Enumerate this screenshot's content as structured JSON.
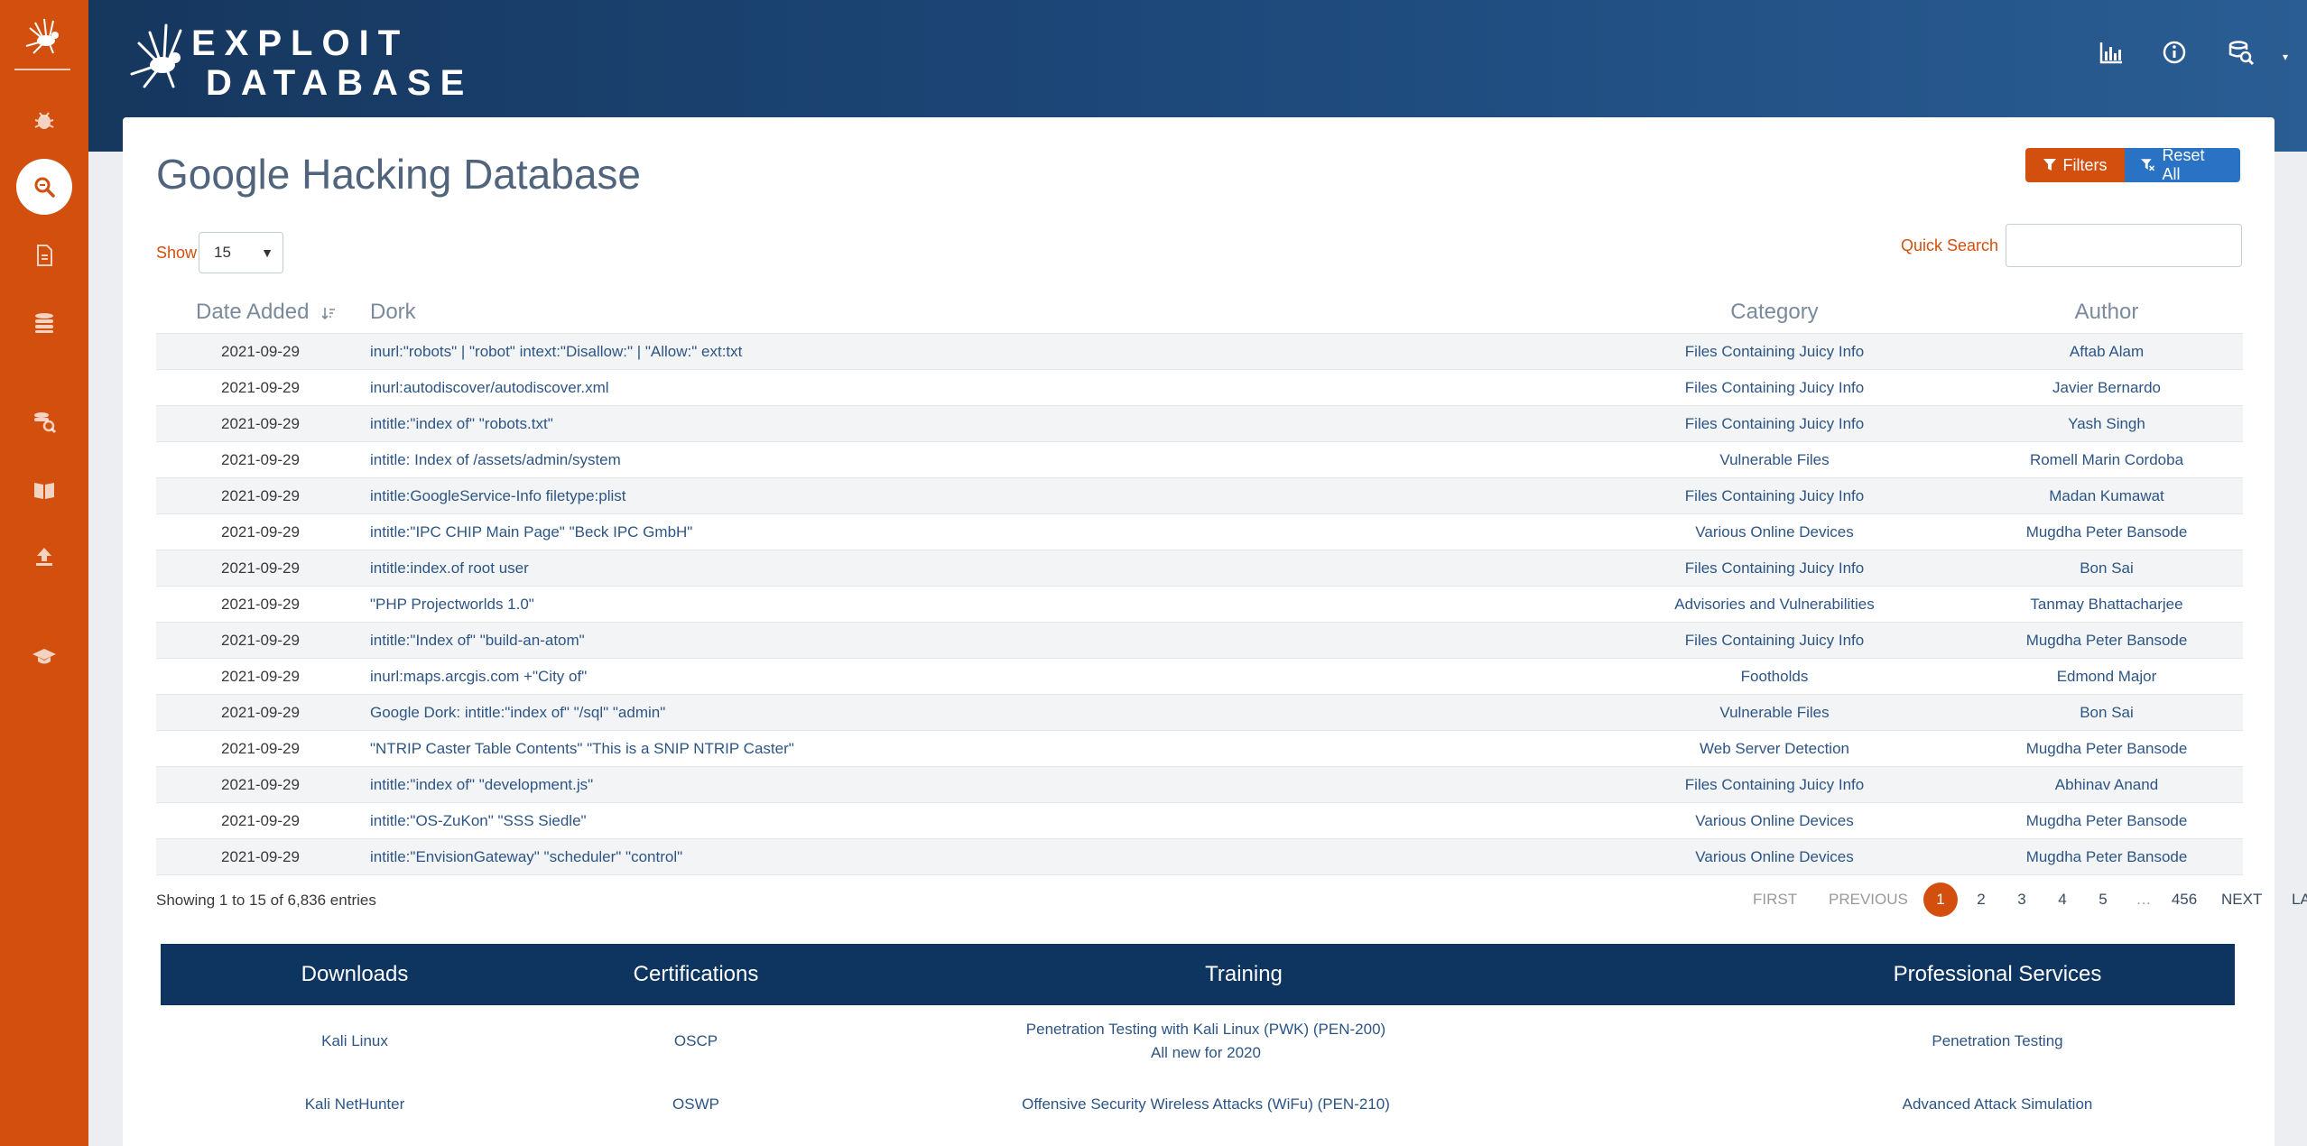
{
  "brand": {
    "line1": "EXPLOIT",
    "line2": "DATABASE"
  },
  "colors": {
    "accent": "#d24f0e",
    "header": "#16375e",
    "link": "#2c5585",
    "reset_button": "#2a73c4"
  },
  "sidebar": {
    "items": [
      {
        "icon": "bug-icon"
      },
      {
        "icon": "search-icon",
        "active": true
      },
      {
        "icon": "file-icon"
      },
      {
        "icon": "database-stack-icon"
      },
      {
        "icon": "search-database-icon"
      },
      {
        "icon": "book-icon"
      },
      {
        "icon": "upload-icon"
      },
      {
        "icon": "graduation-cap-icon"
      }
    ]
  },
  "header_icons": [
    "stats-chart-icon",
    "info-icon",
    "search-database-icon"
  ],
  "page": {
    "title": "Google Hacking Database"
  },
  "buttons": {
    "filters": "Filters",
    "reset_all": "Reset All"
  },
  "controls": {
    "show_label": "Show",
    "show_value": "15",
    "quick_search_label": "Quick Search",
    "quick_search_value": ""
  },
  "table": {
    "columns": {
      "date": "Date Added",
      "dork": "Dork",
      "category": "Category",
      "author": "Author"
    },
    "rows": [
      {
        "date": "2021-09-29",
        "dork": "inurl:\"robots\" | \"robot\" intext:\"Disallow:\" | \"Allow:\" ext:txt",
        "category": "Files Containing Juicy Info",
        "author": "Aftab Alam"
      },
      {
        "date": "2021-09-29",
        "dork": "inurl:autodiscover/autodiscover.xml",
        "category": "Files Containing Juicy Info",
        "author": "Javier Bernardo"
      },
      {
        "date": "2021-09-29",
        "dork": "intitle:\"index of\" \"robots.txt\"",
        "category": "Files Containing Juicy Info",
        "author": "Yash Singh"
      },
      {
        "date": "2021-09-29",
        "dork": "intitle: Index of /assets/admin/system",
        "category": "Vulnerable Files",
        "author": "Romell Marin Cordoba"
      },
      {
        "date": "2021-09-29",
        "dork": "intitle:GoogleService-Info filetype:plist",
        "category": "Files Containing Juicy Info",
        "author": "Madan Kumawat"
      },
      {
        "date": "2021-09-29",
        "dork": "intitle:\"IPC CHIP Main Page\" \"Beck IPC GmbH\"",
        "category": "Various Online Devices",
        "author": "Mugdha Peter Bansode"
      },
      {
        "date": "2021-09-29",
        "dork": "intitle:index.of root user",
        "category": "Files Containing Juicy Info",
        "author": "Bon Sai"
      },
      {
        "date": "2021-09-29",
        "dork": "\"PHP Projectworlds 1.0\"",
        "category": "Advisories and Vulnerabilities",
        "author": "Tanmay Bhattacharjee"
      },
      {
        "date": "2021-09-29",
        "dork": "intitle:\"Index of\" \"build-an-atom\"",
        "category": "Files Containing Juicy Info",
        "author": "Mugdha Peter Bansode"
      },
      {
        "date": "2021-09-29",
        "dork": "inurl:maps.arcgis.com +\"City of\"",
        "category": "Footholds",
        "author": "Edmond Major"
      },
      {
        "date": "2021-09-29",
        "dork": "Google Dork: intitle:\"index of\" \"/sql\" \"admin\"",
        "category": "Vulnerable Files",
        "author": "Bon Sai"
      },
      {
        "date": "2021-09-29",
        "dork": "\"NTRIP Caster Table Contents\" \"This is a SNIP NTRIP Caster\"",
        "category": "Web Server Detection",
        "author": "Mugdha Peter Bansode"
      },
      {
        "date": "2021-09-29",
        "dork": "intitle:\"index of\" \"development.js\"",
        "category": "Files Containing Juicy Info",
        "author": "Abhinav Anand"
      },
      {
        "date": "2021-09-29",
        "dork": "intitle:\"OS-ZuKon\" \"SSS Siedle\"",
        "category": "Various Online Devices",
        "author": "Mugdha Peter Bansode"
      },
      {
        "date": "2021-09-29",
        "dork": "intitle:\"EnvisionGateway\" \"scheduler\" \"control\"",
        "category": "Various Online Devices",
        "author": "Mugdha Peter Bansode"
      }
    ]
  },
  "pagination": {
    "info": "Showing 1 to 15 of 6,836 entries",
    "first": "FIRST",
    "previous": "PREVIOUS",
    "pages": [
      "1",
      "2",
      "3",
      "4",
      "5"
    ],
    "ellipsis": "…",
    "last_page": "456",
    "next": "NEXT",
    "last": "LAST"
  },
  "footer": {
    "headers": [
      "Downloads",
      "Certifications",
      "Training",
      "Professional Services"
    ],
    "row1": [
      "Kali Linux",
      "OSCP",
      "Penetration Testing with Kali Linux (PWK) (PEN-200)",
      "All new for 2020",
      "Penetration Testing"
    ],
    "row2": [
      "Kali NetHunter",
      "OSWP",
      "Offensive Security Wireless Attacks (WiFu) (PEN-210)",
      "Advanced Attack Simulation"
    ]
  }
}
